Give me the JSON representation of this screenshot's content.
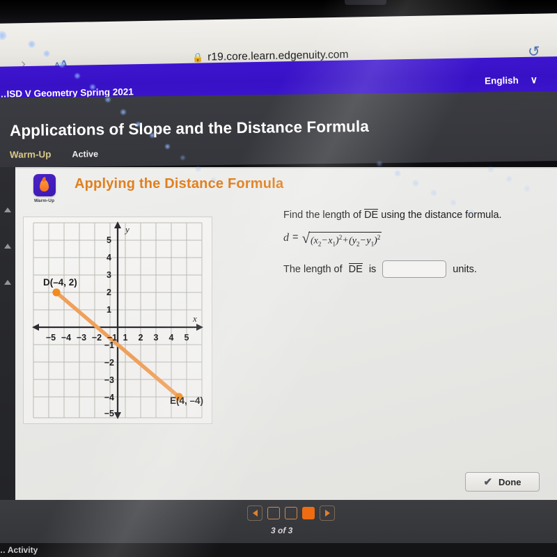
{
  "browser": {
    "back_chevron": "›",
    "aa_label": "AA",
    "lock_icon": "🔒",
    "url": "r19.core.learn.edgenuity.com",
    "reload_icon": "↻"
  },
  "course_band": {
    "course_name": "…ISD V Geometry Spring 2021",
    "language": "English",
    "chevron": "∨",
    "bg_color": "#3811c6"
  },
  "lesson_header": {
    "title": "Applications of Slope and the Distance Formula",
    "tabs": [
      {
        "label": "Warm-Up",
        "color": "#d8c88a"
      },
      {
        "label": "Active",
        "color": "#f0f0f0"
      }
    ]
  },
  "activity": {
    "badge_label": "Warm-Up",
    "badge_icon": "flame-icon",
    "badge_color": "#3c18b5",
    "title": "Applying the Distance Formula",
    "title_color": "#e0801e"
  },
  "question": {
    "prompt_before": "Find the length of ",
    "prompt_segment": "DE",
    "prompt_after": " using the distance formula.",
    "formula": {
      "lhs": "d",
      "equals": "=",
      "radical_sign": "√",
      "body_x2": "x",
      "body_x2_sub": "2",
      "minus": "−",
      "body_x1": "x",
      "body_x1_sub": "1",
      "sup2": "2",
      "plus": "+",
      "body_y2": "y",
      "body_y2_sub": "2",
      "body_y1": "y",
      "body_y1_sub": "1"
    },
    "answer_before": "The length of ",
    "answer_segment": "DE",
    "answer_is": " is",
    "answer_value": "",
    "answer_placeholder": "",
    "answer_units": "units."
  },
  "chart_data": {
    "type": "scatter",
    "title": "",
    "xlabel": "x",
    "ylabel": "y",
    "xlim": [
      -6,
      6
    ],
    "ylim": [
      -6,
      6
    ],
    "xticks": [
      -5,
      -4,
      -3,
      -2,
      -1,
      1,
      2,
      3,
      4,
      5
    ],
    "xtick_labels": [
      "–5",
      "–4",
      "–3",
      "–2",
      "–1",
      "1",
      "2",
      "3",
      "4",
      "5"
    ],
    "yticks": [
      -5,
      -4,
      -3,
      -2,
      -1,
      1,
      2,
      3,
      4,
      5
    ],
    "ytick_labels": [
      "–5",
      "–4",
      "–3",
      "–2",
      "–1",
      "1",
      "2",
      "3",
      "4",
      "5"
    ],
    "grid": true,
    "legend": "none",
    "series": [
      {
        "name": "segment DE",
        "type": "line",
        "color": "#ef9b4e",
        "points": [
          {
            "label": "D",
            "x": -4,
            "y": 2
          },
          {
            "label": "E",
            "x": 4,
            "y": -4
          }
        ]
      }
    ],
    "annotations": [
      {
        "text": "D(–4, 2)",
        "x": -4,
        "y": 2
      },
      {
        "text": "E(4, –4)",
        "x": 4,
        "y": -4
      }
    ]
  },
  "graph_labels": {
    "point_d": "D(–4, 2)",
    "point_e": "E(4, –4)",
    "axis_x": "x",
    "axis_y": "y"
  },
  "footer": {
    "done_label": "Done",
    "check_icon": "✔",
    "prev_icon": "prev-arrow-icon",
    "next_icon": "next-arrow-icon",
    "page_count_text": "3 of 3",
    "page_squares": [
      {
        "active": false
      },
      {
        "active": false
      },
      {
        "active": true
      }
    ],
    "activity_partial": "… Activity"
  }
}
